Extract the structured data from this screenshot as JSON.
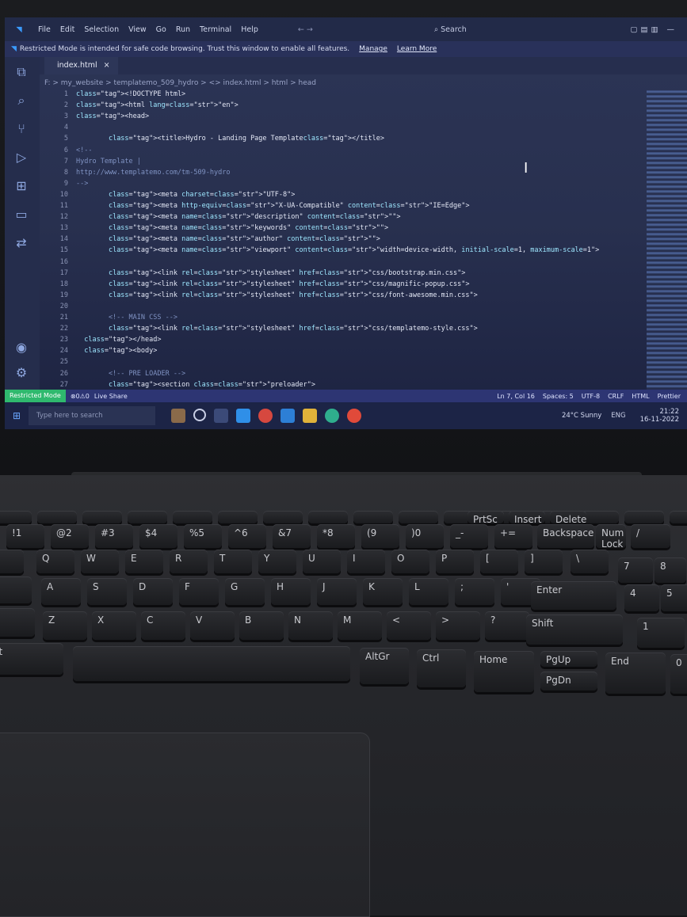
{
  "menubar": {
    "items": [
      "File",
      "Edit",
      "Selection",
      "View",
      "Go",
      "Run",
      "Terminal",
      "Help"
    ],
    "search_label": "Search"
  },
  "banner": {
    "text": "Restricted Mode is intended for safe code browsing. Trust this window to enable all features.",
    "manage": "Manage",
    "learn_more": "Learn More"
  },
  "tab": {
    "label": "index.html",
    "close": "×"
  },
  "breadcrumb": "F: > my_website > templatemo_509_hydro > <> index.html > html > head",
  "editor": {
    "lines": [
      {
        "n": "1",
        "t": "<!DOCTYPE html>"
      },
      {
        "n": "2",
        "t": "<html lang=\"en\">"
      },
      {
        "n": "3",
        "t": "<head>"
      },
      {
        "n": "4",
        "t": ""
      },
      {
        "n": "5",
        "t": "        <title>Hydro - Landing Page Template</title>"
      },
      {
        "n": "6",
        "t": "<!--"
      },
      {
        "n": "7",
        "t": "Hydro Template |"
      },
      {
        "n": "8",
        "t": "http://www.templatemo.com/tm-509-hydro"
      },
      {
        "n": "9",
        "t": "-->"
      },
      {
        "n": "10",
        "t": "        <meta charset=\"UTF-8\">"
      },
      {
        "n": "11",
        "t": "        <meta http-equiv=\"X-UA-Compatible\" content=\"IE=Edge\">"
      },
      {
        "n": "12",
        "t": "        <meta name=\"description\" content=\"\">"
      },
      {
        "n": "13",
        "t": "        <meta name=\"keywords\" content=\"\">"
      },
      {
        "n": "14",
        "t": "        <meta name=\"author\" content=\"\">"
      },
      {
        "n": "15",
        "t": "        <meta name=\"viewport\" content=\"width=device-width, initial-scale=1, maximum-scale=1\">"
      },
      {
        "n": "16",
        "t": ""
      },
      {
        "n": "17",
        "t": "        <link rel=\"stylesheet\" href=\"css/bootstrap.min.css\">"
      },
      {
        "n": "18",
        "t": "        <link rel=\"stylesheet\" href=\"css/magnific-popup.css\">"
      },
      {
        "n": "19",
        "t": "        <link rel=\"stylesheet\" href=\"css/font-awesome.min.css\">"
      },
      {
        "n": "20",
        "t": ""
      },
      {
        "n": "21",
        "t": "        <!-- MAIN CSS -->"
      },
      {
        "n": "22",
        "t": "        <link rel=\"stylesheet\" href=\"css/templatemo-style.css\">"
      },
      {
        "n": "23",
        "t": "  </head>"
      },
      {
        "n": "24",
        "t": "  <body>"
      },
      {
        "n": "25",
        "t": ""
      },
      {
        "n": "26",
        "t": "        <!-- PRE LOADER -->"
      },
      {
        "n": "27",
        "t": "        <section class=\"preloader\">"
      }
    ]
  },
  "statusbar": {
    "mode": "Restricted Mode",
    "counts": "⊗0⚠0",
    "live_share": "Live Share",
    "ln_col": "Ln 7, Col 16",
    "spaces": "Spaces: 5",
    "encoding": "UTF-8",
    "eol": "CRLF",
    "language": "HTML",
    "formatter": "Prettier"
  },
  "taskbar": {
    "search_placeholder": "Type here to search",
    "weather": "24°C  Sunny",
    "lang": "ENG",
    "time": "21:22",
    "date": "16-11-2022"
  },
  "keyboard": {
    "fn_row": [
      "PrtSc",
      "Insert",
      "Delete"
    ],
    "num_row": [
      "!1",
      "@2",
      "#3",
      "$4",
      "%5",
      "^6",
      "&7",
      "*8",
      "(9",
      ")0",
      "_-",
      "+="
    ],
    "top_row": [
      "Q",
      "W",
      "E",
      "R",
      "T",
      "Y",
      "U",
      "I",
      "O",
      "P",
      "[",
      "]"
    ],
    "home_row": [
      "A",
      "S",
      "D",
      "F",
      "G",
      "H",
      "J",
      "K",
      "L",
      ";",
      "'"
    ],
    "bottom_row": [
      "Z",
      "X",
      "C",
      "V",
      "B",
      "N",
      "M",
      "<",
      ">",
      "?"
    ],
    "backspace": "Backspace",
    "enter": "Enter",
    "shift": "Shift",
    "alt": "Alt",
    "altgr": "AltGr",
    "ctrl": "Ctrl",
    "pgup": "PgUp",
    "pgdn": "PgDn",
    "home": "Home",
    "end": "End",
    "numlock": "Num Lock"
  },
  "colors": {
    "vscode_blue": "#3b9bff",
    "statusbar": "#2d3573",
    "restricted": "#2fb96e"
  }
}
